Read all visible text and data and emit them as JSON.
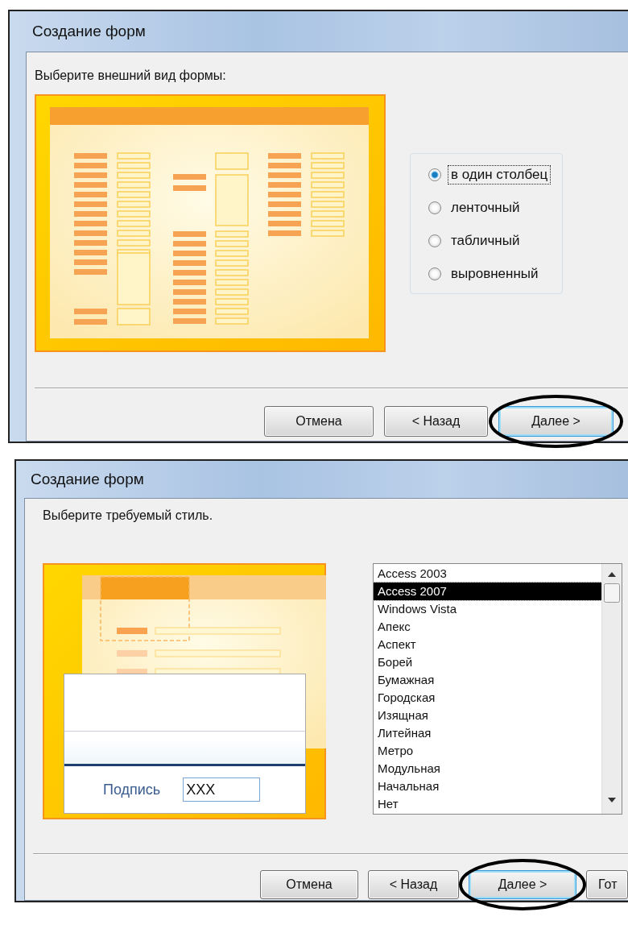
{
  "dialogs": [
    {
      "title": "Создание форм",
      "prompt": "Выберите внешний вид формы:",
      "kind": "layout",
      "options": [
        {
          "label": "в один столбец",
          "selected": true
        },
        {
          "label": "ленточный",
          "selected": false
        },
        {
          "label": "табличный",
          "selected": false
        },
        {
          "label": "выровненный",
          "selected": false
        }
      ],
      "buttons": [
        {
          "label": "Отмена",
          "default": false,
          "circled": false
        },
        {
          "label": "< Назад",
          "default": false,
          "circled": false
        },
        {
          "label": "Далее >",
          "default": true,
          "circled": true
        }
      ]
    },
    {
      "title": "Создание форм",
      "prompt": "Выберите требуемый стиль.",
      "kind": "style",
      "preview": {
        "label": "Подпись",
        "value": "XXX"
      },
      "styles": [
        {
          "label": "Access 2003",
          "selected": false
        },
        {
          "label": "Access 2007",
          "selected": true
        },
        {
          "label": "Windows Vista",
          "selected": false
        },
        {
          "label": "Апекс",
          "selected": false
        },
        {
          "label": "Аспект",
          "selected": false
        },
        {
          "label": "Борей",
          "selected": false
        },
        {
          "label": "Бумажная",
          "selected": false
        },
        {
          "label": "Городская",
          "selected": false
        },
        {
          "label": "Изящная",
          "selected": false
        },
        {
          "label": "Литейная",
          "selected": false
        },
        {
          "label": "Метро",
          "selected": false
        },
        {
          "label": "Модульная",
          "selected": false
        },
        {
          "label": "Начальная",
          "selected": false
        },
        {
          "label": "Нет",
          "selected": false
        }
      ],
      "buttons": [
        {
          "label": "Отмена",
          "default": false,
          "circled": false
        },
        {
          "label": "< Назад",
          "default": false,
          "circled": false
        },
        {
          "label": "Далее >",
          "default": true,
          "circled": true
        },
        {
          "label": "Гот",
          "default": false,
          "circled": false
        }
      ]
    }
  ]
}
